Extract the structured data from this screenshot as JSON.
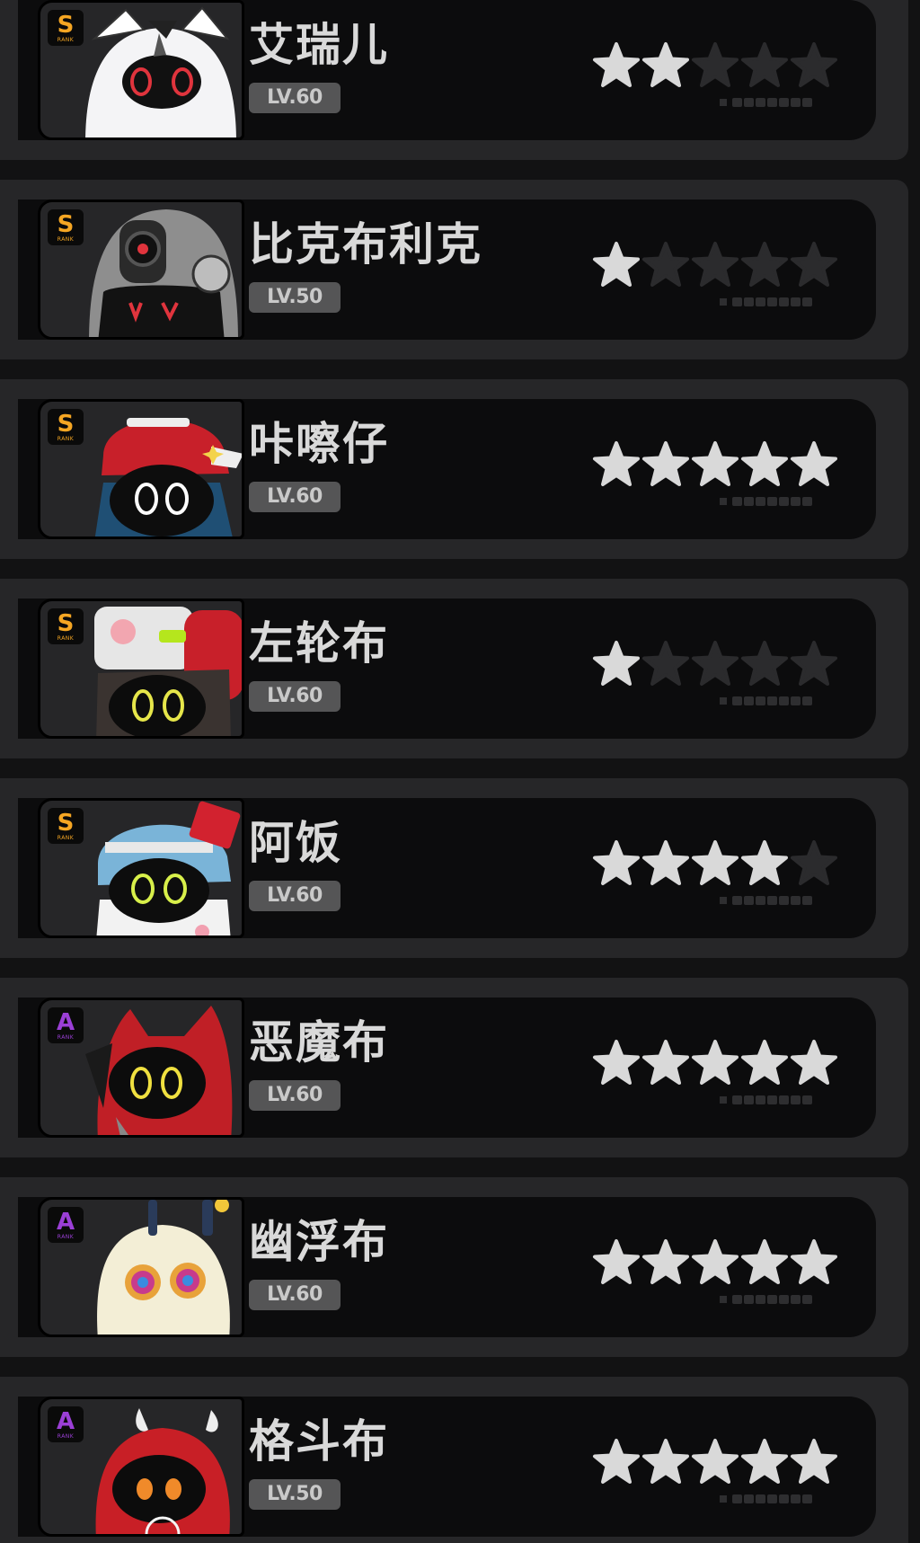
{
  "colors": {
    "star_on": "#d9d9d9",
    "star_off": "#2b2b2d",
    "rank_s": "#f5a623",
    "rank_a": "#9b3fd6"
  },
  "units": [
    {
      "name": "艾瑞儿",
      "level": "LV.60",
      "rank": "S",
      "rank_sub": "RANK",
      "stars": 2,
      "avatar": "elaine-avatar"
    },
    {
      "name": "比克布利克",
      "level": "LV.50",
      "rank": "S",
      "rank_sub": "RANK",
      "stars": 1,
      "avatar": "bikebrick-avatar"
    },
    {
      "name": "咔嚓仔",
      "level": "LV.60",
      "rank": "S",
      "rank_sub": "RANK",
      "stars": 5,
      "avatar": "kachazai-avatar"
    },
    {
      "name": "左轮布",
      "level": "LV.60",
      "rank": "S",
      "rank_sub": "RANK",
      "stars": 1,
      "avatar": "revolver-avatar"
    },
    {
      "name": "阿饭",
      "level": "LV.60",
      "rank": "S",
      "rank_sub": "RANK",
      "stars": 4,
      "avatar": "afan-avatar"
    },
    {
      "name": "恶魔布",
      "level": "LV.60",
      "rank": "A",
      "rank_sub": "RANK",
      "stars": 5,
      "avatar": "devil-avatar"
    },
    {
      "name": "幽浮布",
      "level": "LV.60",
      "rank": "A",
      "rank_sub": "RANK",
      "stars": 5,
      "avatar": "ufo-avatar"
    },
    {
      "name": "格斗布",
      "level": "LV.50",
      "rank": "A",
      "rank_sub": "RANK",
      "stars": 5,
      "avatar": "fighter-avatar"
    }
  ]
}
